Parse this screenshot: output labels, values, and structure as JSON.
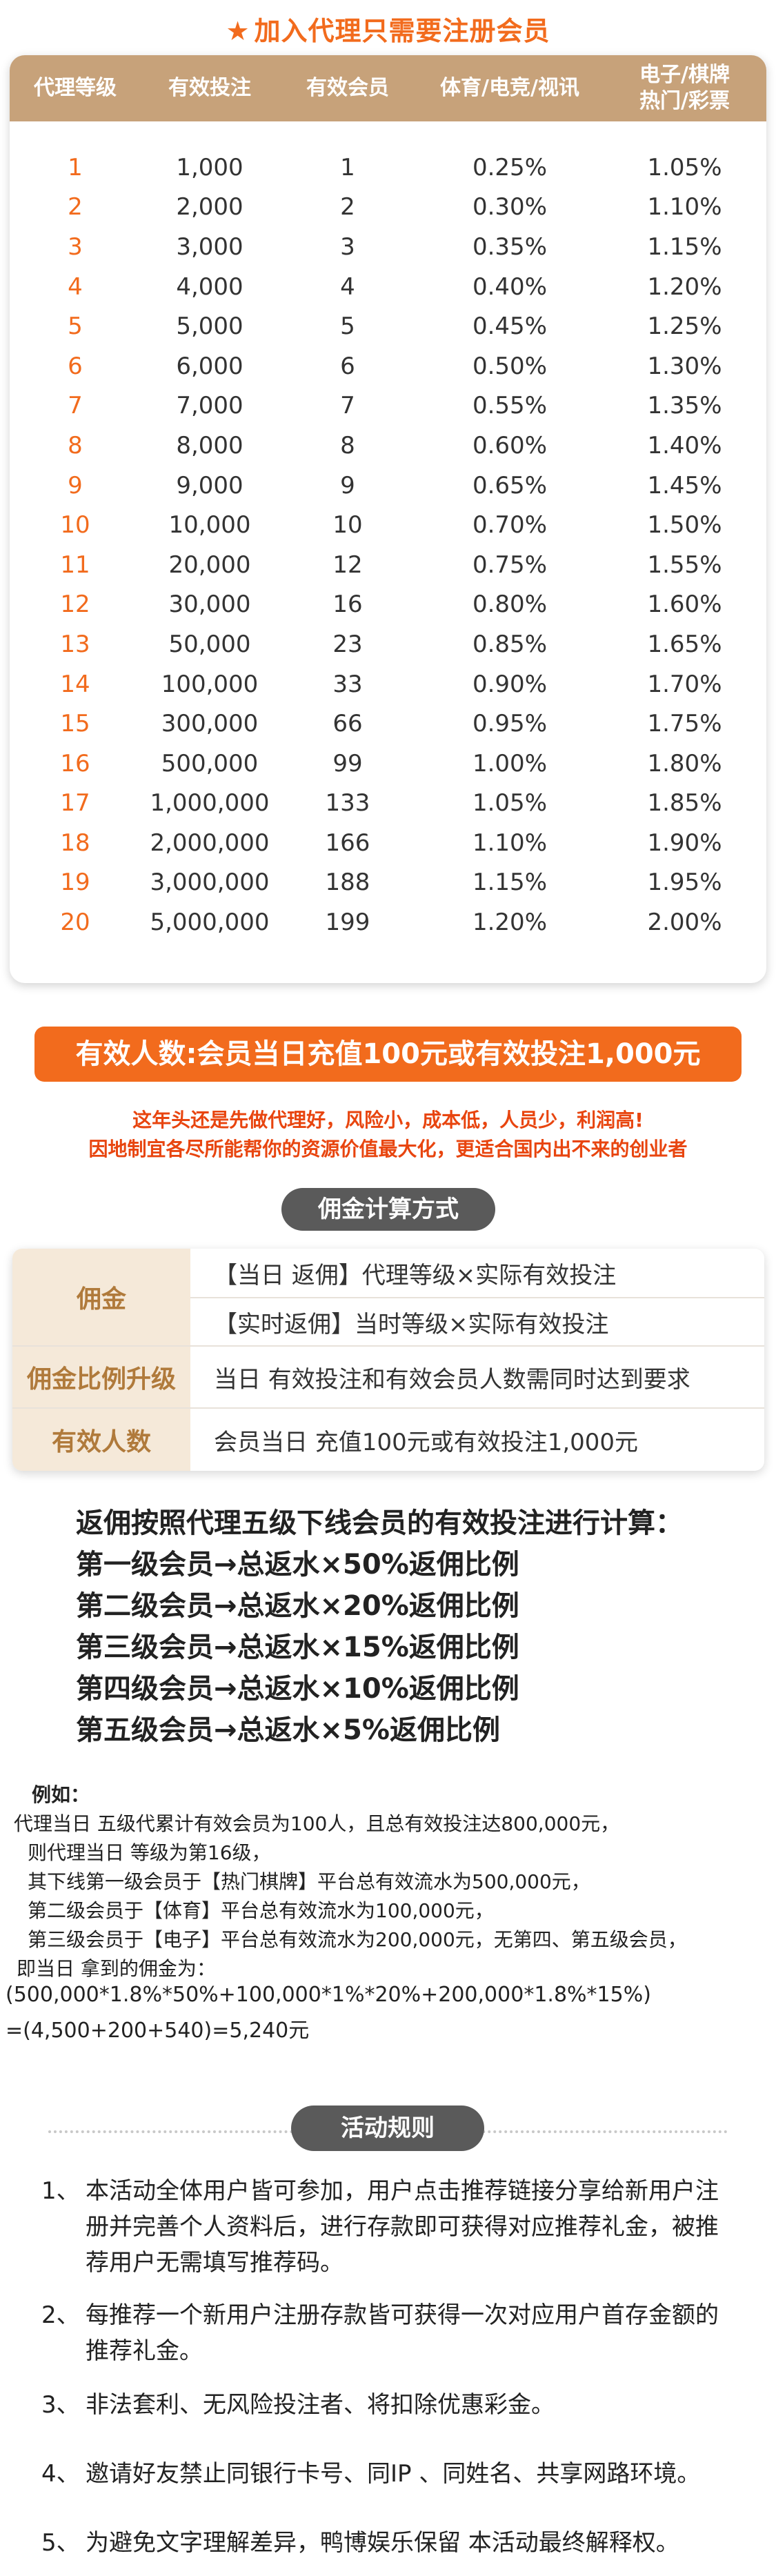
{
  "top": {
    "title": "加入代理只需要注册会员",
    "star_icon": "★",
    "headers": [
      "代理等级",
      "有效投注",
      "有效会员",
      "体育/电竞/视讯",
      "电子/棋牌\n热门/彩票"
    ],
    "rows": [
      [
        "1",
        "1,000",
        "1",
        "0.25%",
        "1.05%"
      ],
      [
        "2",
        "2,000",
        "2",
        "0.30%",
        "1.10%"
      ],
      [
        "3",
        "3,000",
        "3",
        "0.35%",
        "1.15%"
      ],
      [
        "4",
        "4,000",
        "4",
        "0.40%",
        "1.20%"
      ],
      [
        "5",
        "5,000",
        "5",
        "0.45%",
        "1.25%"
      ],
      [
        "6",
        "6,000",
        "6",
        "0.50%",
        "1.30%"
      ],
      [
        "7",
        "7,000",
        "7",
        "0.55%",
        "1.35%"
      ],
      [
        "8",
        "8,000",
        "8",
        "0.60%",
        "1.40%"
      ],
      [
        "9",
        "9,000",
        "9",
        "0.65%",
        "1.45%"
      ],
      [
        "10",
        "10,000",
        "10",
        "0.70%",
        "1.50%"
      ],
      [
        "11",
        "20,000",
        "12",
        "0.75%",
        "1.55%"
      ],
      [
        "12",
        "30,000",
        "16",
        "0.80%",
        "1.60%"
      ],
      [
        "13",
        "50,000",
        "23",
        "0.85%",
        "1.65%"
      ],
      [
        "14",
        "100,000",
        "33",
        "0.90%",
        "1.70%"
      ],
      [
        "15",
        "300,000",
        "66",
        "0.95%",
        "1.75%"
      ],
      [
        "16",
        "500,000",
        "99",
        "1.00%",
        "1.80%"
      ],
      [
        "17",
        "1,000,000",
        "133",
        "1.05%",
        "1.85%"
      ],
      [
        "18",
        "2,000,000",
        "166",
        "1.10%",
        "1.90%"
      ],
      [
        "19",
        "3,000,000",
        "188",
        "1.15%",
        "1.95%"
      ],
      [
        "20",
        "5,000,000",
        "199",
        "1.20%",
        "2.00%"
      ]
    ]
  },
  "banner": {
    "text": "有效人数:会员当日充值100元或有效投注1,000元",
    "slogan1": "这年头还是先做代理好，风险小，成本低，人员少，利润高!",
    "slogan2": "因地制宜各尽所能帮你的资源价值最大化，更适合国内出不来的创业者"
  },
  "commission": {
    "title": "佣金计算方式",
    "label_commission": "佣金",
    "daily": "【当日 返佣】代理等级×实际有效投注",
    "realtime": "【实时返佣】当时等级×实际有效投注",
    "label_upgrade": "佣金比例升级",
    "upgrade": "当日 有效投注和有效会员人数需同时达到要求",
    "label_active": "有效人数",
    "active": "会员当日 充值100元或有效投注1,000元"
  },
  "rebate": {
    "intro": "返佣按照代理五级下线会员的有效投注进行计算：",
    "levels": [
      "第一级会员→总返水×50%返佣比例",
      "第二级会员→总返水×20%返佣比例",
      "第三级会员→总返水×15%返佣比例",
      "第四级会员→总返水×10%返佣比例",
      "第五级会员→总返水×5%返佣比例"
    ]
  },
  "example": {
    "label": "例如：",
    "lines": [
      "代理当日 五级代累计有效会员为100人，且总有效投注达800,000元，",
      "则代理当日 等级为第16级，",
      "其下线第一级会员于【热门棋牌】平台总有效流水为500,000元，",
      "第二级会员于【体育】平台总有效流水为100,000元，",
      "第三级会员于【电子】平台总有效流水为200,000元，无第四、第五级会员，",
      "即当日 拿到的佣金为："
    ],
    "formula1": "(500,000*1.8%*50%+100,000*1%*20%+200,000*1.8%*15%)",
    "formula2": "=(4,500+200+540)=5,240元"
  },
  "rules": {
    "title": "活动规则",
    "items": [
      {
        "num": "1、",
        "text": "本活动全体用户皆可参加，用户点击推荐链接分享给新用户注册并完善个人资料后，进行存款即可获得对应推荐礼金，被推荐用户无需填写推荐码。"
      },
      {
        "num": "2、",
        "text": "每推荐一个新用户注册存款皆可获得一次对应用户首存金额的推荐礼金。"
      },
      {
        "num": "3、",
        "text": "非法套利、无风险投注者、将扣除优惠彩金。"
      },
      {
        "num": "4、",
        "text": "邀请好友禁止同银行卡号、同IP 、同姓名、共享网路环境。"
      },
      {
        "num": "5、",
        "text": "为避免文字理解差异，鸭博娱乐保留 本活动最终解释权。"
      }
    ]
  }
}
